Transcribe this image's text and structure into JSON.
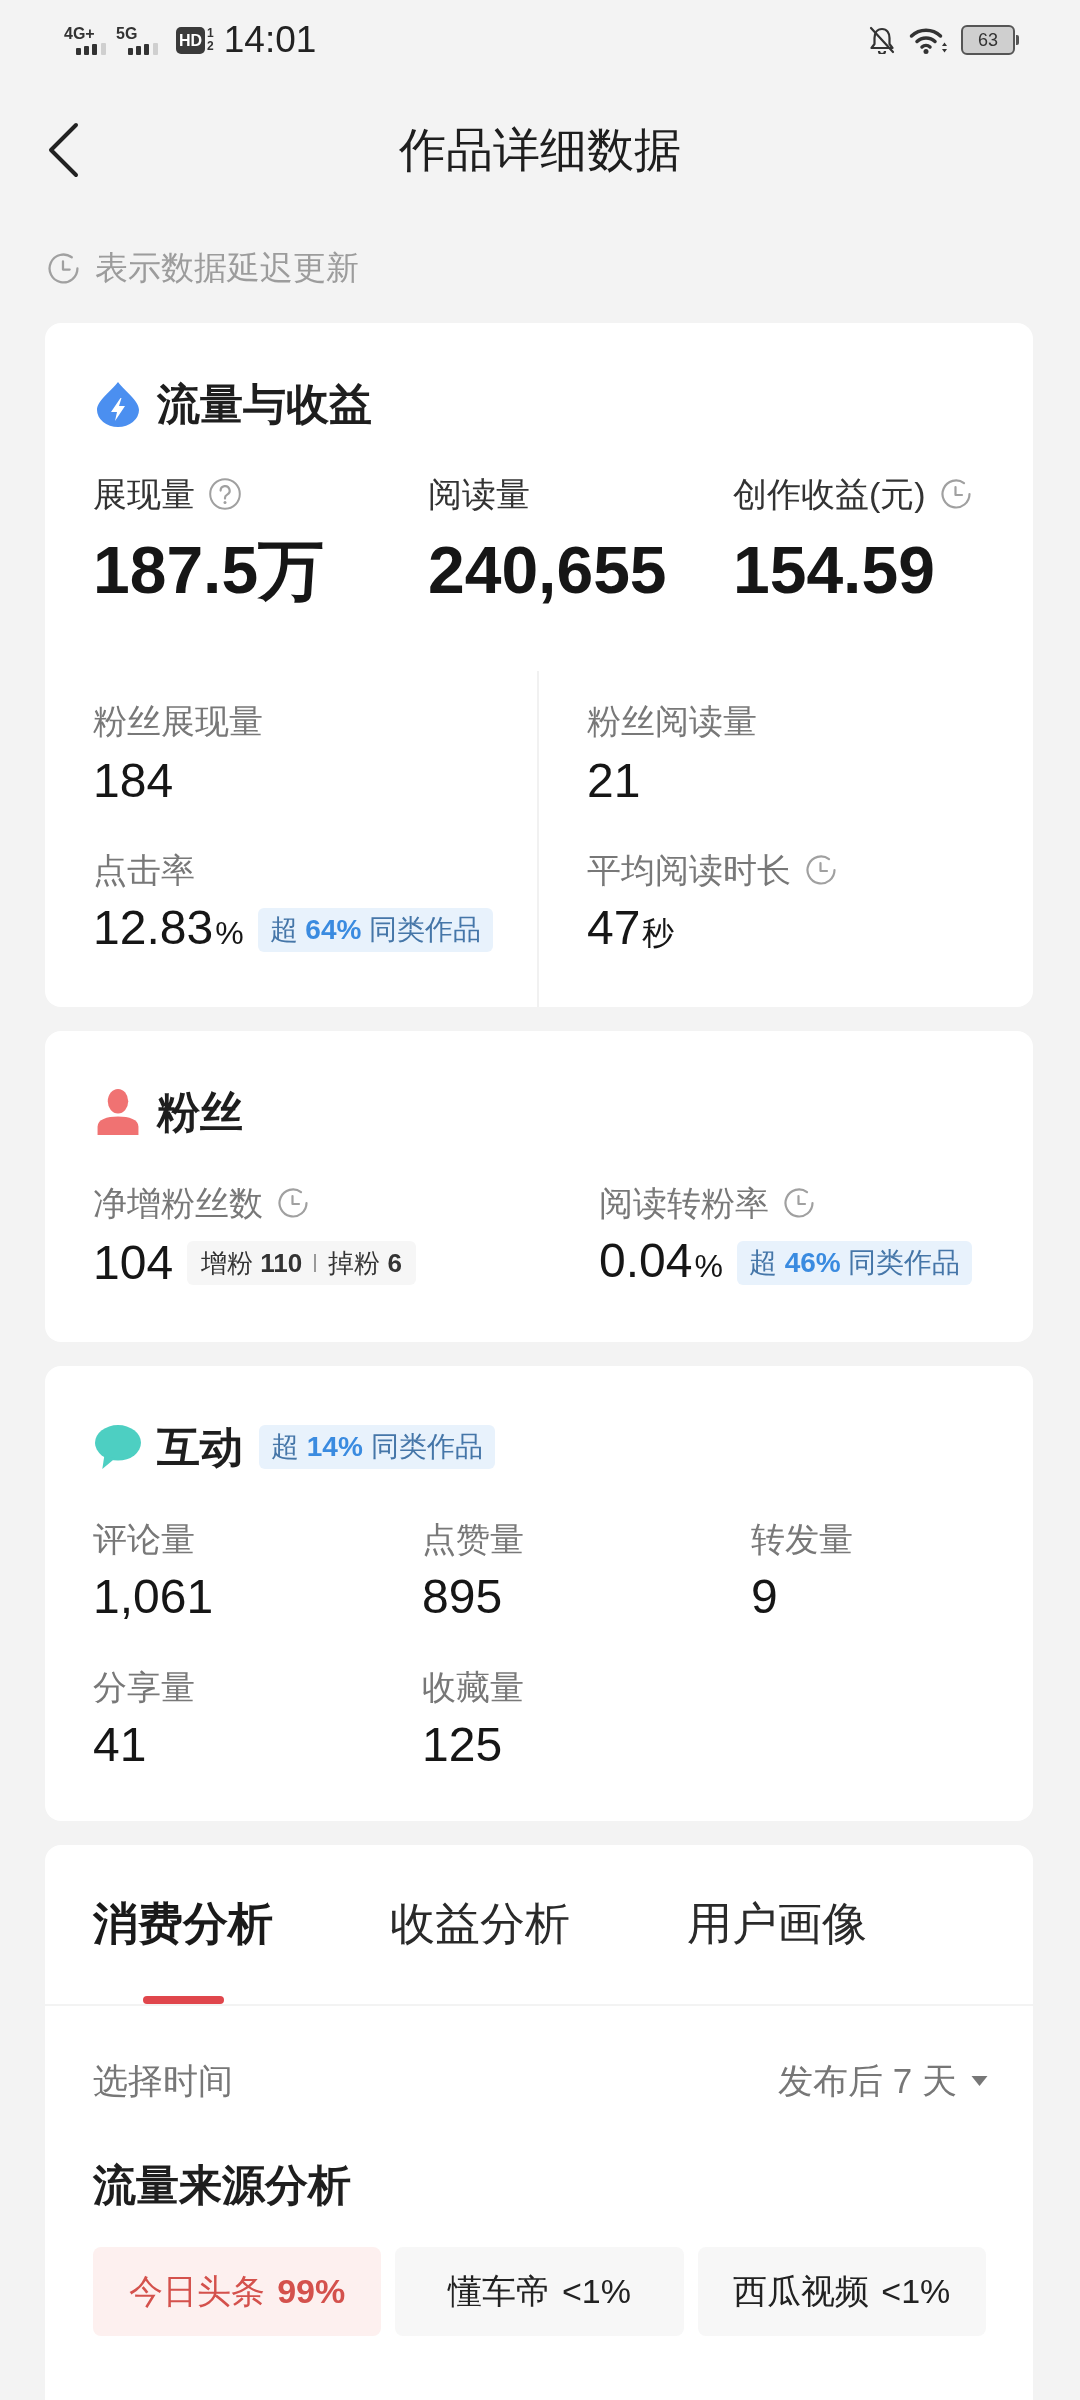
{
  "status_bar": {
    "networks": [
      {
        "label": "4G+"
      },
      {
        "label": "5G"
      }
    ],
    "hd_badge": "HD",
    "sim_slots": [
      "1",
      "2"
    ],
    "time": "14:01",
    "battery": "63"
  },
  "header": {
    "title": "作品详细数据"
  },
  "notice": {
    "text": "表示数据延迟更新"
  },
  "traffic_card": {
    "title": "流量与收益",
    "metrics": [
      {
        "kind": "help",
        "label": "展现量",
        "value": "187.5万"
      },
      {
        "kind": "plain",
        "label": "阅读量",
        "value": "240,655"
      },
      {
        "kind": "delayed",
        "label": "创作收益(元)",
        "value": "154.59"
      }
    ],
    "fan_metrics": [
      {
        "kind": "plain",
        "label": "粉丝展现量",
        "value": "184"
      },
      {
        "kind": "plain",
        "label": "粉丝阅读量",
        "value": "21"
      },
      {
        "kind": "plain",
        "label": "点击率",
        "value": "12.83",
        "unit": "%",
        "badge": "超 **64%** 同类作品"
      },
      {
        "kind": "delayed",
        "label": "平均阅读时长",
        "value": "47",
        "unit": "秒"
      }
    ]
  },
  "fans_card": {
    "title": "粉丝",
    "metrics": [
      {
        "kind": "delayed",
        "label": "净增粉丝数",
        "value": "104",
        "breakdown": [
          {
            "label": "增粉",
            "value": "110"
          },
          {
            "label": "掉粉",
            "value": "6"
          }
        ]
      },
      {
        "kind": "delayed",
        "label": "阅读转粉率",
        "value": "0.04",
        "unit": "%",
        "badge": "超 **46%** 同类作品"
      }
    ]
  },
  "interaction_card": {
    "title": "互动",
    "badge": "超 **14%** 同类作品",
    "metrics": [
      {
        "label": "评论量",
        "value": "1,061"
      },
      {
        "label": "点赞量",
        "value": "895"
      },
      {
        "label": "转发量",
        "value": "9"
      },
      {
        "label": "分享量",
        "value": "41"
      },
      {
        "label": "收藏量",
        "value": "125"
      }
    ]
  },
  "analysis_card": {
    "tabs": [
      {
        "label": "消费分析",
        "selected": true
      },
      {
        "label": "收益分析",
        "selected": false
      },
      {
        "label": "用户画像",
        "selected": false
      }
    ],
    "time_filter": {
      "label": "选择时间",
      "value": "发布后 7 天"
    },
    "section_title": "流量来源分析",
    "sources": [
      {
        "name": "今日头条",
        "share": "99%",
        "selected": true
      },
      {
        "name": "懂车帝",
        "share": "<1%",
        "selected": false
      },
      {
        "name": "西瓜视频",
        "share": "<1%",
        "selected": false
      }
    ]
  }
}
